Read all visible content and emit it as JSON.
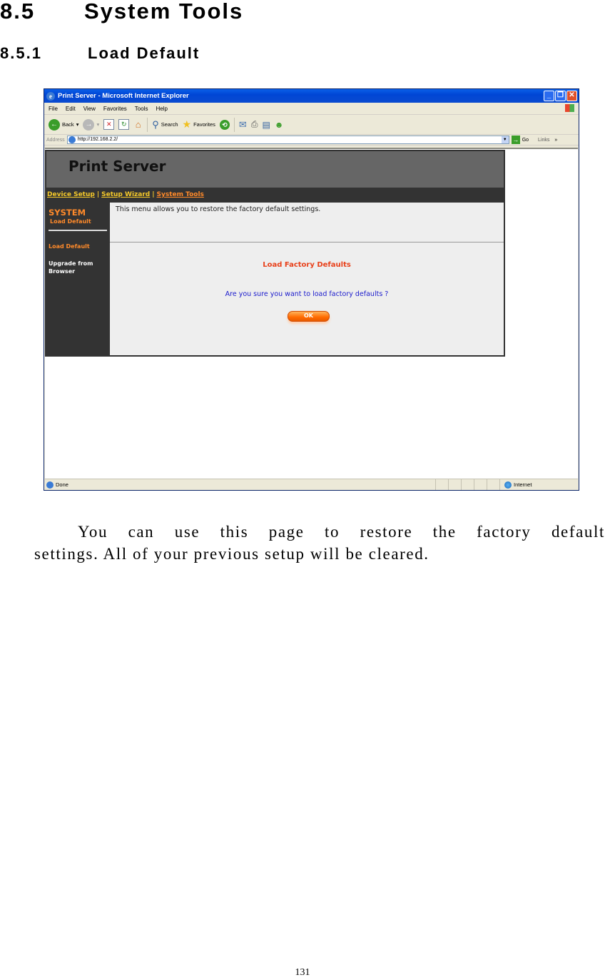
{
  "doc": {
    "section_number": "8.5",
    "section_title": "System Tools",
    "subsection_number": "8.5.1",
    "subsection_title": "Load Default",
    "paragraph_line1": "You can use this page to restore the factory default",
    "paragraph_line2": "settings. All of your previous setup will be cleared.",
    "page_number": "131"
  },
  "browser": {
    "title": "Print Server - Microsoft Internet Explorer",
    "menu": [
      "File",
      "Edit",
      "View",
      "Favorites",
      "Tools",
      "Help"
    ],
    "toolbar": {
      "back": "Back",
      "search": "Search",
      "favorites": "Favorites"
    },
    "address_label": "Address",
    "address_value": "http://192.168.2.2/",
    "go_label": "Go",
    "links_label": "Links",
    "status_text": "Done",
    "zone_text": "Internet"
  },
  "page": {
    "title": "Print Server",
    "nav": [
      "Device Setup",
      "Setup Wizard",
      "System Tools"
    ],
    "nav_separator": "|",
    "sidebar": {
      "heading": "SYSTEM",
      "subheading": "Load Default",
      "items": [
        "Load Default",
        "Upgrade from Browser"
      ]
    },
    "description": "This menu allows you to restore the factory default settings.",
    "section_heading": "Load Factory Defaults",
    "question": "Are you sure you want to load factory defaults ?",
    "ok_label": "OK",
    "colors": {
      "accent_orange": "#ff8a2a",
      "nav_yellow": "#f4c82a",
      "heading_red": "#e8401a",
      "question_blue": "#1a1acc"
    }
  }
}
